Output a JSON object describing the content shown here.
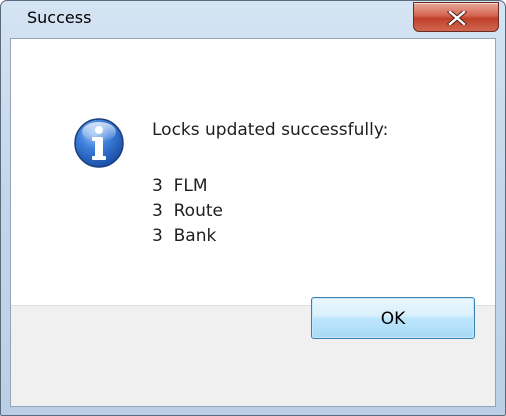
{
  "window": {
    "title": "Success",
    "close_icon": "close-icon"
  },
  "dialog": {
    "icon": "info-icon",
    "message": "Locks updated successfully:",
    "lines": [
      "3  FLM",
      "3  Route",
      "3  Bank"
    ],
    "ok_label": "OK"
  },
  "colors": {
    "close_button": "#c9503a",
    "ok_button_border": "#3c7fb1",
    "info_icon": "#2f6fd1",
    "footer_background": "#f0f0f0"
  }
}
